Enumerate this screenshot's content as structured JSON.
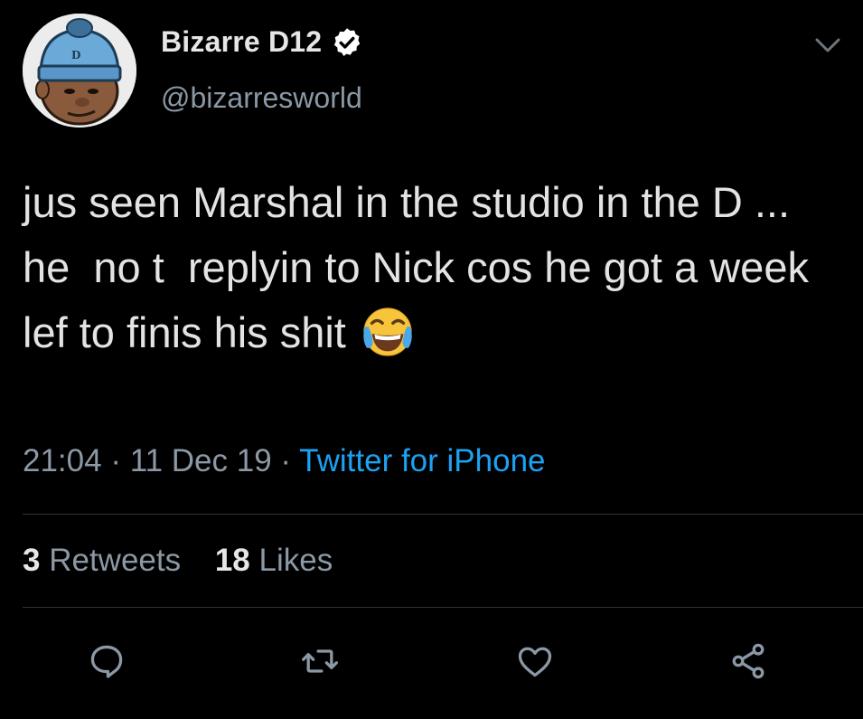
{
  "author": {
    "display_name": "Bizarre D12",
    "handle": "@bizarresworld",
    "verified": true,
    "avatar_icon": "cartoon-avatar-blue-beanie"
  },
  "tweet": {
    "text": "jus seen Marshal in the studio in the D ... he  no t  replyin to Nick cos he got a week lef to finis his shit",
    "emoji": "face-with-tears-of-joy",
    "time": "21:04",
    "date": "11 Dec 19",
    "source": "Twitter for iPhone",
    "separator": "·"
  },
  "stats": {
    "retweets_count": "3",
    "retweets_label": "Retweets",
    "likes_count": "18",
    "likes_label": "Likes"
  },
  "actions": {
    "reply_icon": "reply-icon",
    "retweet_icon": "retweet-icon",
    "like_icon": "like-icon",
    "share_icon": "share-icon"
  },
  "colors": {
    "background": "#000000",
    "accent": "#1da1f2",
    "muted": "#8b98a5",
    "text": "#e3e3e3"
  }
}
